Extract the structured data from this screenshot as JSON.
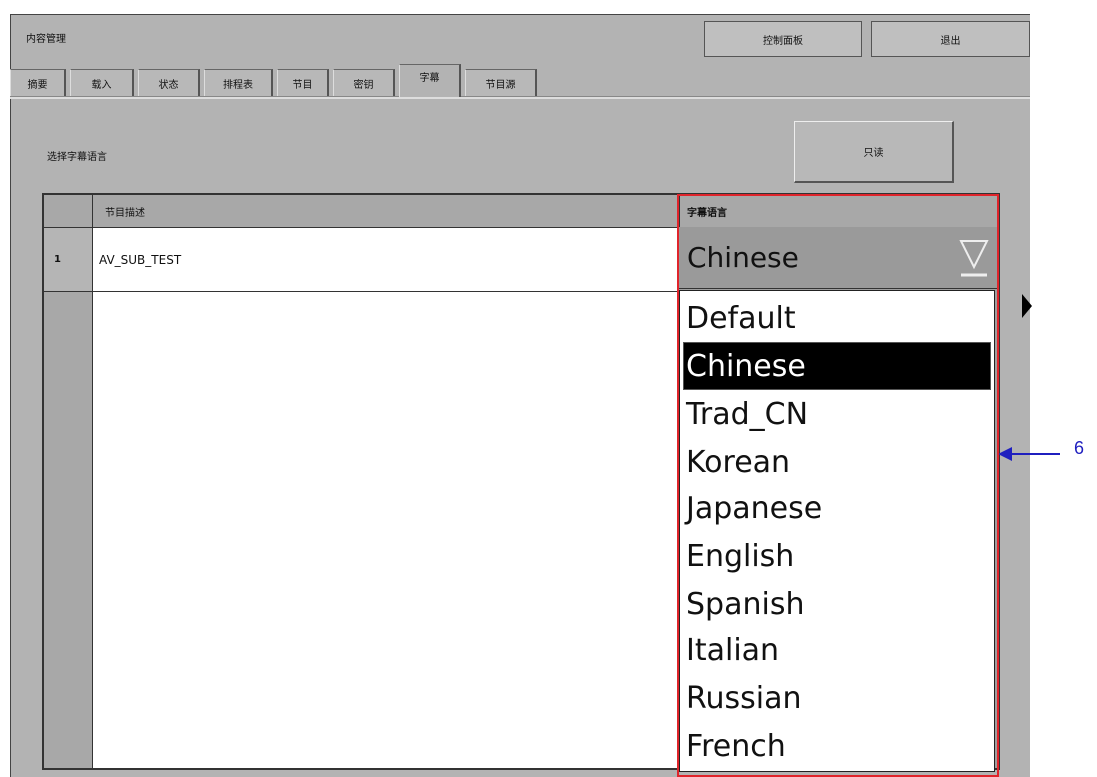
{
  "window": {
    "title": "内容管理",
    "control_panel_label": "控制面板",
    "exit_label": "退出"
  },
  "tabs": [
    {
      "label": "摘要",
      "active": false
    },
    {
      "label": "载入",
      "active": false
    },
    {
      "label": "状态",
      "active": false
    },
    {
      "label": "排程表",
      "active": false
    },
    {
      "label": "节目",
      "active": false
    },
    {
      "label": "密钥",
      "active": false
    },
    {
      "label": "字幕",
      "active": true
    },
    {
      "label": "节目源",
      "active": false
    }
  ],
  "subtitle_page": {
    "select_label": "选择字幕语言",
    "readonly_label": "只读",
    "table": {
      "headers": {
        "description": "节目描述",
        "subtitle_language": "字幕语言"
      },
      "rows": [
        {
          "index": "1",
          "description": "AV_SUB_TEST",
          "language": "Chinese"
        }
      ]
    },
    "dropdown": {
      "selected": "Chinese",
      "options": [
        "Default",
        "Chinese",
        "Trad_CN",
        "Korean",
        "Japanese",
        "English",
        "Spanish",
        "Italian",
        "Russian",
        "French"
      ]
    }
  },
  "annotation": {
    "label": "6",
    "color": "#1f1fbf",
    "highlight_color": "#e0242b"
  }
}
